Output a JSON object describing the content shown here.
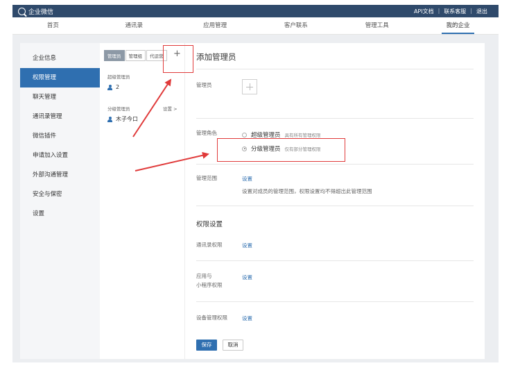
{
  "topbar": {
    "brand": "企业微信",
    "links": [
      "API文档",
      "联系客服",
      "退出"
    ]
  },
  "nav": {
    "items": [
      "首页",
      "通讯录",
      "应用管理",
      "客户联系",
      "管理工具",
      "我的企业"
    ],
    "active": "我的企业"
  },
  "sidebar": {
    "items": [
      "企业信息",
      "权限管理",
      "聊天管理",
      "通讯录管理",
      "微信插件",
      "申请加入设置",
      "外部沟通管理",
      "安全与保密",
      "设置"
    ],
    "active": "权限管理"
  },
  "midcol": {
    "tabs": [
      "管理员",
      "管理组",
      "代运营"
    ],
    "plus": "+",
    "super_admin_label": "超级管理员",
    "super_admin_count": "2",
    "sub_admin_label": "分级管理员",
    "sub_admin_setting": "设置 >",
    "sub_admin_user": "木子今口"
  },
  "content": {
    "heading": "添加管理员",
    "admin_label": "管理员",
    "role_label": "管理角色",
    "role_super": "超级管理员",
    "role_super_desc": "具有所有管理权限",
    "role_sub": "分级管理员",
    "role_sub_desc": "仅有部分管理权限",
    "scope_label": "管理范围",
    "scope_link": "设置",
    "scope_note": "设置对成员的管理范围，权限设置均不得超出此管理范围",
    "perm_title": "权限设置",
    "contacts_perm_label": "通讯录权限",
    "contacts_perm_link": "设置",
    "app_perm_label_line1": "应用与",
    "app_perm_label_line2": "小程序权限",
    "app_perm_link": "设置",
    "device_perm_label": "设备管理权限",
    "device_perm_link": "设置",
    "save": "保存",
    "cancel": "取消"
  },
  "colors": {
    "topbar": "#2f4a6b",
    "accent": "#2f6fb0",
    "annotation": "#e03a3a"
  }
}
